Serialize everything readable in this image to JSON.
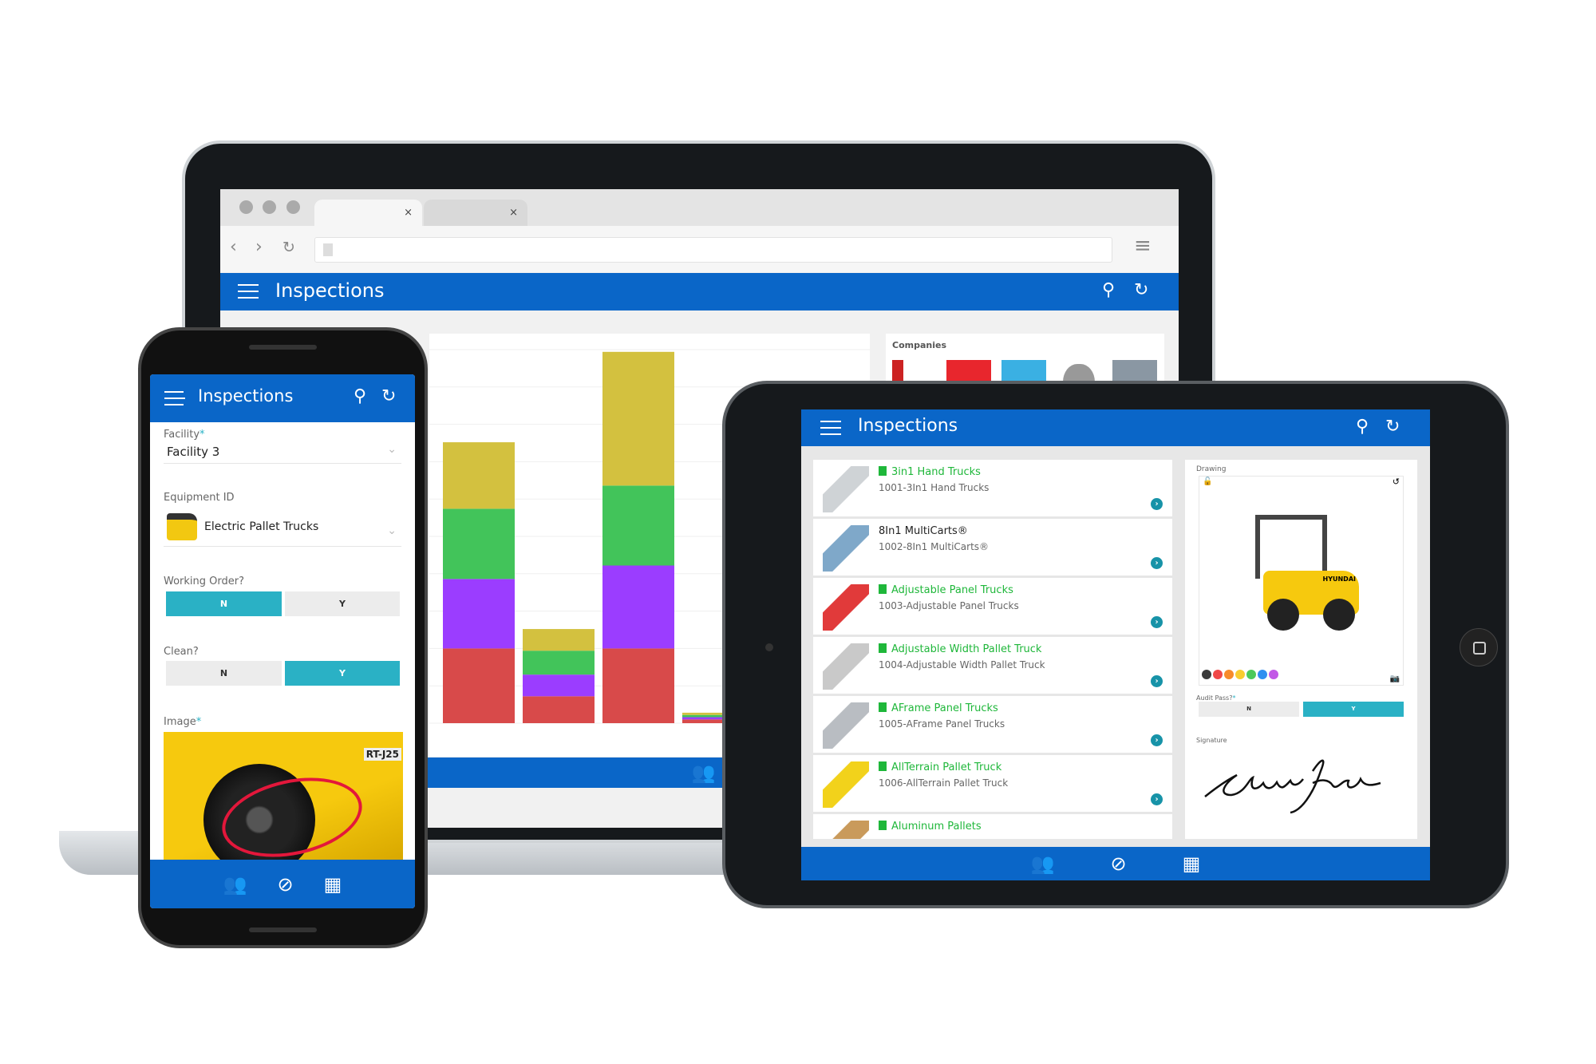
{
  "laptop": {
    "browser": {
      "tabs": [
        {
          "close": "×"
        },
        {
          "close": "×"
        }
      ],
      "nav": {
        "back": "‹",
        "forward": "›",
        "reload": "↻",
        "menu": "≡"
      }
    },
    "app": {
      "title": "Inspections",
      "companies_label": "Companies"
    }
  },
  "chart_data": {
    "type": "bar",
    "stacked": true,
    "title": "",
    "xlabel": "",
    "ylabel": "",
    "categories": [
      "",
      "",
      "",
      ""
    ],
    "series": [
      {
        "color": "#d84a4a",
        "values": [
          10,
          3.6,
          10,
          0.5
        ]
      },
      {
        "color": "#9b3dff",
        "values": [
          9.3,
          2.9,
          11.1,
          0.3
        ]
      },
      {
        "color": "#42c45a",
        "values": [
          9.4,
          3.2,
          10.7,
          0.3
        ]
      },
      {
        "color": "#d3c13f",
        "values": [
          8.9,
          2.9,
          17.9,
          0.3
        ]
      }
    ],
    "ylim": [
      0,
      50
    ],
    "grid": true,
    "legend": "none"
  },
  "phone": {
    "title": "Inspections",
    "facility": {
      "label": "Facility",
      "required": "*",
      "value": "Facility 3"
    },
    "equipment": {
      "label": "Equipment ID",
      "value": "Electric Pallet Trucks"
    },
    "working_order": {
      "label": "Working Order?",
      "options": [
        "N",
        "Y"
      ],
      "selected": "N"
    },
    "clean": {
      "label": "Clean?",
      "options": [
        "N",
        "Y"
      ],
      "selected": "Y"
    },
    "image": {
      "label": "Image",
      "required": "*",
      "plate": "RT-J25"
    }
  },
  "tablet": {
    "title": "Inspections",
    "list": [
      {
        "title": "3in1 Hand Trucks",
        "subtitle": "1001-3In1 Hand Trucks",
        "has_icon": true
      },
      {
        "title": "8In1 MultiCarts®",
        "subtitle": "1002-8In1 MultiCarts®",
        "has_icon": false
      },
      {
        "title": "Adjustable Panel Trucks",
        "subtitle": "1003-Adjustable Panel Trucks",
        "has_icon": true
      },
      {
        "title": "Adjustable Width Pallet Truck",
        "subtitle": "1004-Adjustable Width Pallet Truck",
        "has_icon": true
      },
      {
        "title": "AFrame Panel Trucks",
        "subtitle": "1005-AFrame Panel Trucks",
        "has_icon": true
      },
      {
        "title": "AllTerrain Pallet Truck",
        "subtitle": "1006-AllTerrain Pallet Truck",
        "has_icon": true
      },
      {
        "title": "Aluminum Pallets",
        "subtitle": "",
        "has_icon": true
      }
    ],
    "drawing": {
      "label": "Drawing",
      "brand": "HYUNDAI",
      "colors": [
        "#3a3a3a",
        "#f04848",
        "#f78b2a",
        "#f9cd2f",
        "#4cc95a",
        "#2f8ff0",
        "#c258e6"
      ]
    },
    "audit_pass": {
      "label": "Audit Pass?",
      "required": "*",
      "options": [
        "N",
        "Y"
      ],
      "selected": "Y"
    },
    "signature": {
      "label": "Signature"
    }
  },
  "colors": {
    "brand_blue": "#0a66c8",
    "accent_teal": "#2ab1c5",
    "list_green": "#1fb73a"
  }
}
